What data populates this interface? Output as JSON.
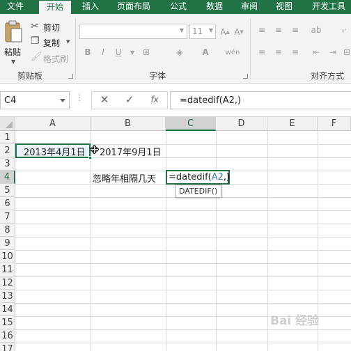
{
  "ribbon_tabs": [
    "文件",
    "开始",
    "插入",
    "页面布局",
    "公式",
    "数据",
    "审阅",
    "视图",
    "开发工具"
  ],
  "clipboard": {
    "paste": "粘贴",
    "cut": "剪切",
    "copy": "复制",
    "format_painter": "格式刷",
    "group": "剪贴板"
  },
  "font": {
    "size": "11",
    "group": "字体",
    "bold": "B",
    "italic": "I",
    "underline": "U"
  },
  "alignment": {
    "group": "对齐方式"
  },
  "formula_bar": {
    "name_box": "C4",
    "fx": "fx",
    "formula": "=datedif(A2,)"
  },
  "columns": [
    "A",
    "B",
    "C",
    "D",
    "E",
    "F"
  ],
  "rows": [
    "1",
    "2",
    "3",
    "4",
    "5",
    "6",
    "7",
    "8",
    "9",
    "10",
    "11",
    "12",
    "13",
    "14",
    "15",
    "16",
    "17"
  ],
  "cells": {
    "A2": "2013年4月1日",
    "B2": "2017年9月1日",
    "B4": "忽略年相隔几天",
    "C4_prefix": "=datedif(",
    "C4_ref": "A2",
    "C4_suffix": ",)"
  },
  "tooltip": "DATEDIF()",
  "watermark": "Bai 经验",
  "colors": {
    "accent": "#217346",
    "ref_blue": "#3b7bb4"
  }
}
